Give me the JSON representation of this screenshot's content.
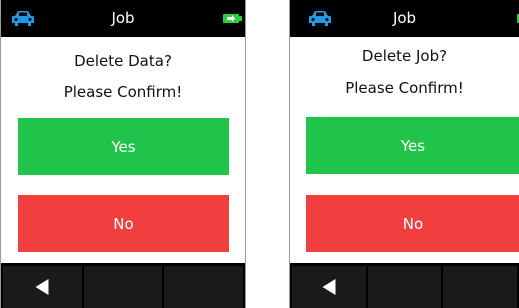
{
  "screens": [
    {
      "header_title": "Job",
      "icons": {
        "left": "car-icon",
        "right": "battery-charging-icon"
      },
      "message_line1": "Delete Data?",
      "message_line2": "Please Confirm!",
      "yes_label": "Yes",
      "no_label": "No",
      "footer": [
        "back-arrow-icon",
        "",
        ""
      ]
    },
    {
      "header_title": "Job",
      "icons": {
        "left": "car-icon",
        "right": "battery-charging-icon"
      },
      "message_line1": "Delete Job?",
      "message_line2": "Please Confirm!",
      "yes_label": "Yes",
      "no_label": "No",
      "footer": [
        "back-arrow-icon",
        "",
        ""
      ]
    }
  ],
  "colors": {
    "header_bg": "#000000",
    "car_icon": "#1e9be0",
    "battery": "#2ecc40",
    "yes": "#21c44a",
    "no": "#f13f3f"
  }
}
